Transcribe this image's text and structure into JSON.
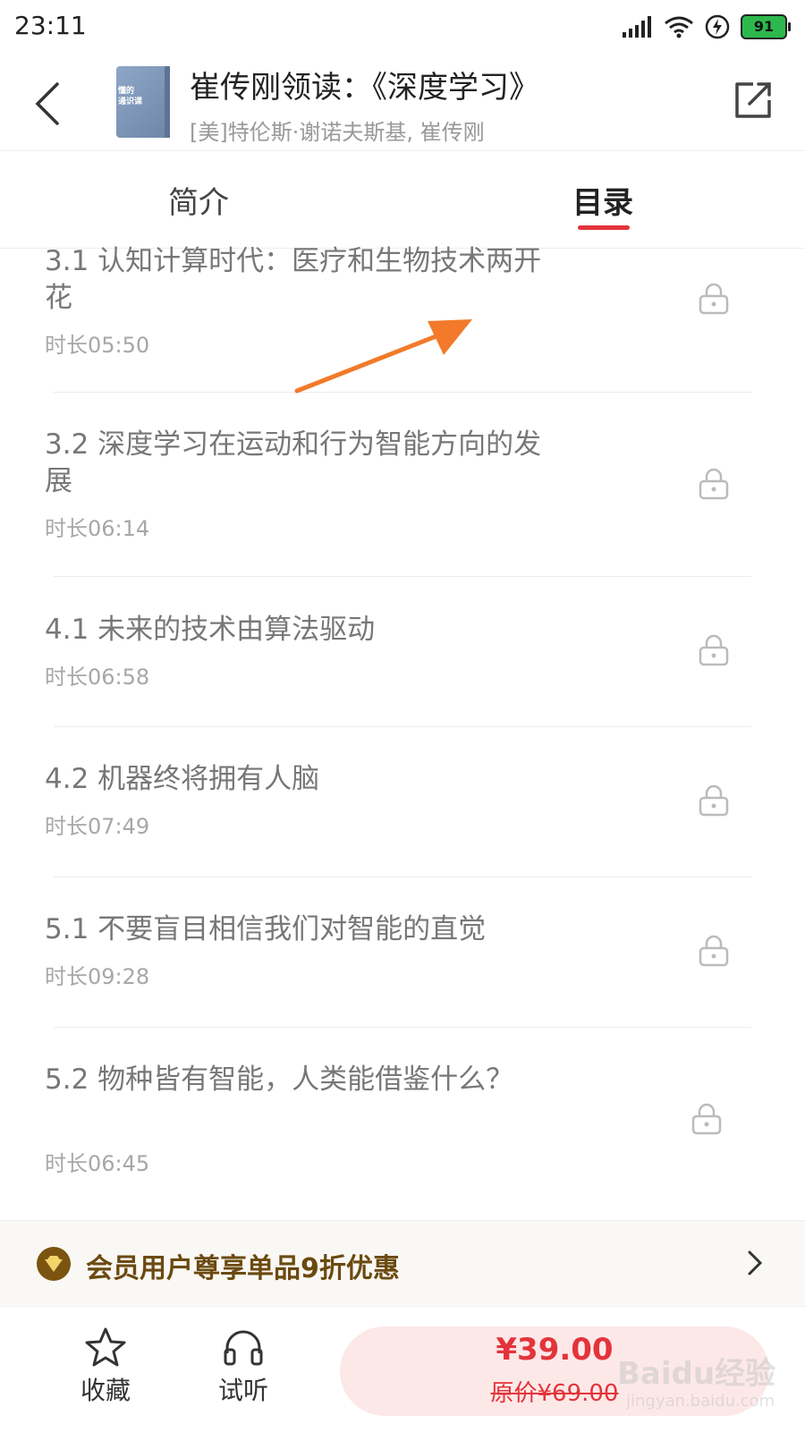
{
  "status_bar": {
    "time": "23:11",
    "battery": "91"
  },
  "header": {
    "cover_text": "懂的\n通识课",
    "title": "崔传刚领读：《深度学习》",
    "subtitle": "[美]特伦斯·谢诺夫斯基, 崔传刚"
  },
  "tabs": {
    "intro": "简介",
    "toc": "目录"
  },
  "chapters": [
    {
      "title": "3.1 认知计算时代：医疗和生物技术两开花",
      "duration": "时长05:50"
    },
    {
      "title": "3.2 深度学习在运动和行为智能方向的发展",
      "duration": "时长06:14"
    },
    {
      "title": "4.1 未来的技术由算法驱动",
      "duration": "时长06:58"
    },
    {
      "title": "4.2 机器终将拥有人脑",
      "duration": "时长07:49"
    },
    {
      "title": "5.1 不要盲目相信我们对智能的直觉",
      "duration": "时长09:28"
    },
    {
      "title": "5.2 物种皆有智能，人类能借鉴什么？",
      "duration": "时长06:45"
    }
  ],
  "vip_banner": {
    "text": "会员用户尊享单品9折优惠"
  },
  "bottom_bar": {
    "favorite_label": "收藏",
    "listen_label": "试听",
    "price": "¥39.00",
    "original_price": "原价¥69.00"
  },
  "watermark": {
    "main": "Baidu经验",
    "sub": "jingyan.baidu.com"
  },
  "colors": {
    "accent": "#e3343b",
    "vip_text": "#6b4a10",
    "battery": "#2db84d",
    "annotation_arrow": "#f27a2a"
  }
}
